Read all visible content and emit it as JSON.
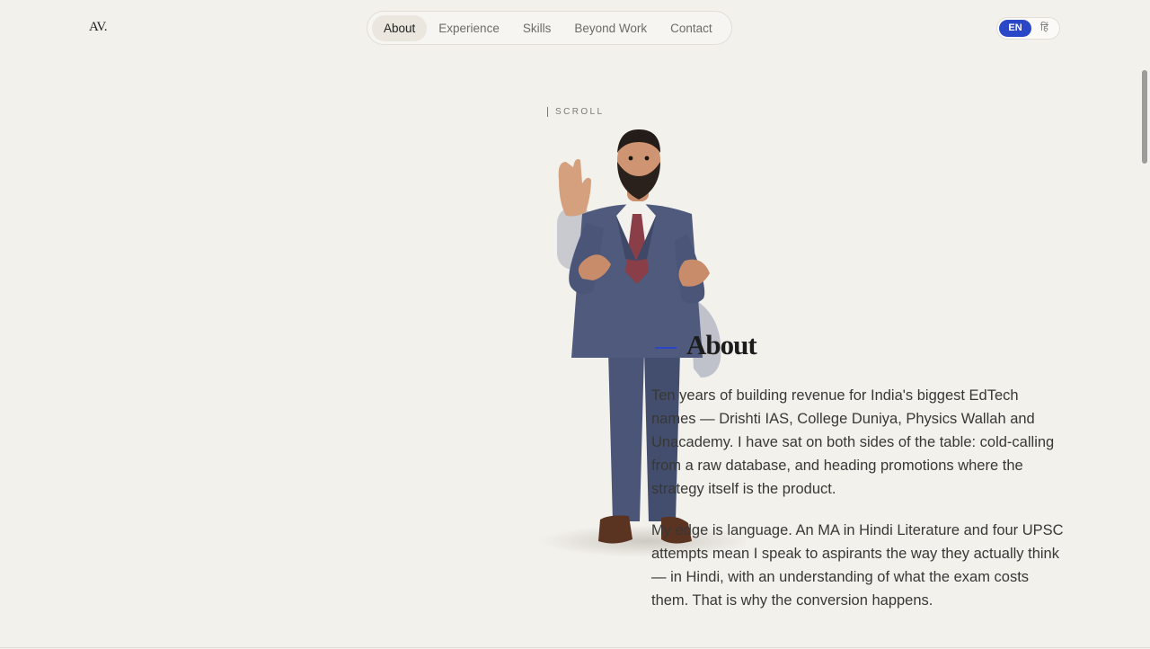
{
  "brand": {
    "logo": "AV."
  },
  "nav": {
    "items": [
      {
        "label": "About",
        "active": true
      },
      {
        "label": "Experience",
        "active": false
      },
      {
        "label": "Skills",
        "active": false
      },
      {
        "label": "Beyond Work",
        "active": false
      },
      {
        "label": "Contact",
        "active": false
      }
    ]
  },
  "lang": {
    "en": "EN",
    "hi": "हिं"
  },
  "hero": {
    "scroll_label": "SCROLL"
  },
  "about": {
    "title": "About",
    "paragraphs": [
      "Ten years of building revenue for India's biggest EdTech names — Drishti IAS, College Duniya, Physics Wallah and Unacademy. I have sat on both sides of the table: cold-calling from a raw database, and heading promotions where the strategy itself is the product.",
      "My edge is language. An MA in Hindi Literature and four UPSC attempts mean I speak to aspirants the way they actually think — in Hindi, with an understanding of what the exam costs them. That is why the conversion happens."
    ]
  },
  "colors": {
    "accent": "#2a47c8",
    "background": "#f3f1ec",
    "suit": "#4a5577",
    "tie": "#8a3e48"
  }
}
